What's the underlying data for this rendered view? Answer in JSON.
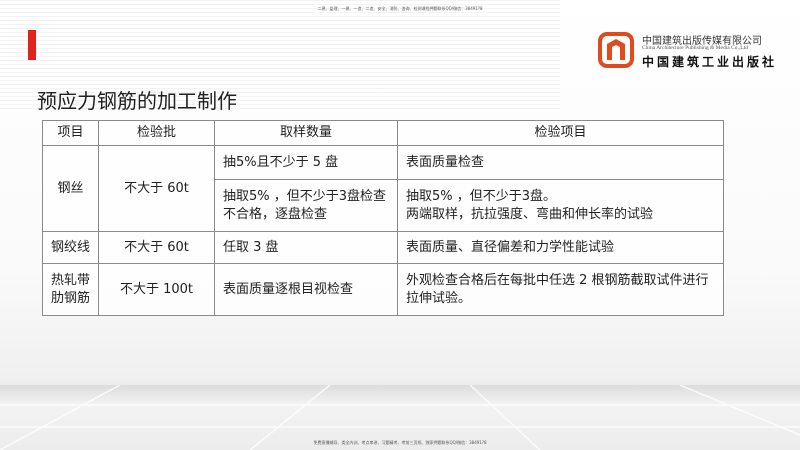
{
  "top_note": "二建、监理、一建、一造、二造、安全、消防、咨询、检测课程押题联系QQ/微信：38491?8",
  "bottom_note": "免费直播辅导、类全内训、考点串讲、习题精考、考前三页纸、独家押题联系QQ/微信：38491?8",
  "logo": {
    "cn": "中国建筑出版传媒有限公司",
    "en": "China Architecture Publishing & Media Co.,Ltd",
    "cn2": "中国建筑工业出版社"
  },
  "title": "预应力钢筋的加工制作",
  "table": {
    "headers": [
      "项目",
      "检验批",
      "取样数量",
      "检验项目"
    ],
    "rows": [
      {
        "item": "钢丝",
        "batch": "不大于 60t",
        "sample_a": "抽5%且不少于 5 盘",
        "inspect_a": "表面质量检查",
        "sample_b": "抽取5% ，但不少于3盘检查不合格，逐盘检查",
        "inspect_b1": "抽取5% ，但不少于3盘。",
        "inspect_b2": "两端取样，抗拉强度、弯曲和伸长率的试验"
      },
      {
        "item": "钢绞线",
        "batch": "不大于 60t",
        "sample": "任取 3 盘",
        "inspect": "表面质量、直径偏差和力学性能试验"
      },
      {
        "item": "热轧带肋钢筋",
        "batch": "不大于 100t",
        "sample": "表面质量逐根目视检查",
        "inspect": "外观检查合格后在每批中任选 2 根钢筋截取试件进行拉伸试验。"
      }
    ]
  }
}
